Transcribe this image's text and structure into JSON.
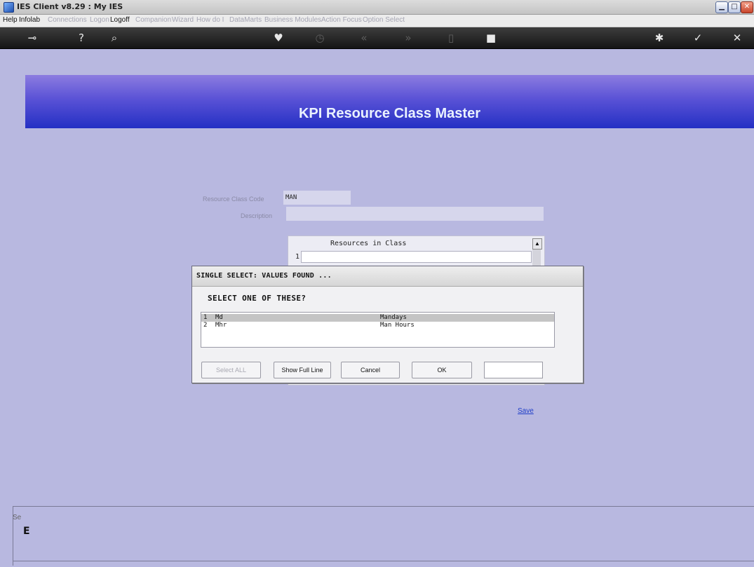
{
  "window": {
    "title": "IES Client v8.29 : My IES",
    "controls": {
      "minimize": "▁",
      "maximize": "□",
      "close": "✕"
    }
  },
  "menu": [
    {
      "label": "Help",
      "enabled": true
    },
    {
      "label": "Infolab",
      "enabled": true
    },
    {
      "label": "Connections",
      "enabled": false
    },
    {
      "label": "Logon",
      "enabled": false
    },
    {
      "label": "Logoff",
      "enabled": true
    },
    {
      "label": "Companion",
      "enabled": false
    },
    {
      "label": "Wizard",
      "enabled": false
    },
    {
      "label": "How do I",
      "enabled": false
    },
    {
      "label": "DataMarts",
      "enabled": false
    },
    {
      "label": "Business Modules",
      "enabled": false
    },
    {
      "label": "Action Focus",
      "enabled": false
    },
    {
      "label": "Option Select",
      "enabled": false
    }
  ],
  "toolbar": [
    {
      "icon": "key-icon",
      "glyph": "⊸",
      "enabled": true
    },
    {
      "icon": "help-icon",
      "glyph": "?",
      "enabled": true
    },
    {
      "icon": "search-icon",
      "glyph": "⌕",
      "enabled": true
    },
    {
      "icon": "heart-icon",
      "glyph": "♥",
      "enabled": true
    },
    {
      "icon": "clock-icon",
      "glyph": "◷",
      "enabled": false
    },
    {
      "icon": "rewind-icon",
      "glyph": "«",
      "enabled": false
    },
    {
      "icon": "forward-icon",
      "glyph": "»",
      "enabled": false
    },
    {
      "icon": "page-icon",
      "glyph": "▯",
      "enabled": false
    },
    {
      "icon": "stop-icon",
      "glyph": "■",
      "enabled": true
    },
    {
      "icon": "gear-icon",
      "glyph": "✱",
      "enabled": true
    },
    {
      "icon": "check-icon",
      "glyph": "✓",
      "enabled": true
    },
    {
      "icon": "close-icon",
      "glyph": "✕",
      "enabled": true
    }
  ],
  "page": {
    "title": "KPI Resource Class Master"
  },
  "form": {
    "resource_class_code": {
      "label": "Resource Class Code",
      "value": "MAN"
    },
    "description": {
      "label": "Description",
      "value": ""
    },
    "resources": {
      "header": "Resources in Class",
      "row_number": "1",
      "scroll_up": "▲"
    }
  },
  "save_link": "Save",
  "side": {
    "tab_label": "Se",
    "glyph": "E"
  },
  "dialog": {
    "title": "SINGLE SELECT: VALUES FOUND ...",
    "prompt": "SELECT ONE OF THESE?",
    "rows": [
      {
        "num": "1",
        "code": "Md",
        "description": "Mandays",
        "selected": true
      },
      {
        "num": "2",
        "code": "Mhr",
        "description": "Man Hours",
        "selected": false
      }
    ],
    "buttons": {
      "select_all": "Select ALL",
      "show_full_line": "Show Full Line",
      "cancel": "Cancel",
      "ok": "OK"
    },
    "filter_value": ""
  },
  "colors": {
    "background": "#b8b8e0",
    "banner_top": "#8c7ce0",
    "banner_bottom": "#2430c4",
    "link": "#1f3ec8",
    "toolbar": "#222222"
  }
}
